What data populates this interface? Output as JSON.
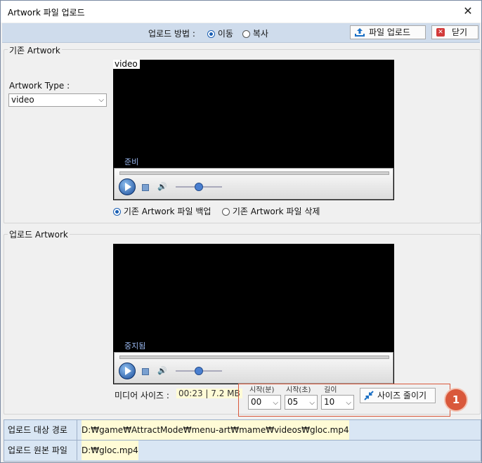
{
  "window": {
    "title": "Artwork 파일 업로드",
    "close_glyph": "✕"
  },
  "toolbar": {
    "method_label": "업로드 방법 :",
    "move_label": "이동",
    "copy_label": "복사",
    "selected_method": "이동",
    "upload_button": "파일 업로드",
    "close_button": "닫기"
  },
  "existing": {
    "group_title": "기존 Artwork",
    "type_label": "Artwork Type :",
    "type_value": "video",
    "video_tag": "video",
    "status": "준비",
    "backup_label": "기존 Artwork 파일 백업",
    "delete_label": "기존 Artwork 파일 삭제",
    "selected_option": "backup"
  },
  "upload": {
    "group_title": "업로드 Artwork",
    "status": "중지됨",
    "media_size_label": "미디어 사이즈 :",
    "media_size_value": "00:23 | 7.2 MB",
    "start_min_label": "시작(분)",
    "start_sec_label": "시작(초)",
    "length_label": "길이",
    "start_min_value": "00",
    "start_sec_value": "05",
    "length_value": "10",
    "shrink_button": "사이즈 줄이기",
    "callout_number": "1"
  },
  "info": {
    "target_label": "업로드 대상 경로",
    "target_value": "D:₩game₩AttractMode₩menu-art₩mame₩videos₩gloc.mp4",
    "source_label": "업로드 원본 파일",
    "source_value": "D:₩gloc.mp4"
  },
  "colors": {
    "accent": "#1a5fb4",
    "callout": "#d9583b",
    "highlight_box": "#d9583b"
  }
}
